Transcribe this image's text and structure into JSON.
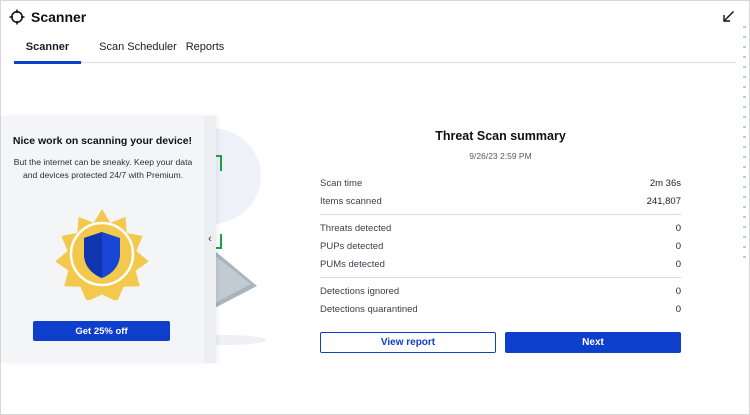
{
  "app": {
    "title": "Scanner"
  },
  "tabs": [
    {
      "label": "Scanner",
      "active": true
    },
    {
      "label": "Scan Scheduler",
      "active": false
    },
    {
      "label": "Reports",
      "active": false
    }
  ],
  "promo": {
    "title": "Nice work on scanning your device!",
    "body": "But the internet can be sneaky. Keep your data and devices protected 24/7 with Premium.",
    "button_label": "Get 25% off",
    "handle_glyph": "‹"
  },
  "summary": {
    "title": "Threat Scan summary",
    "date": "9/26/23 2:59 PM",
    "groups": [
      [
        {
          "label": "Scan time",
          "value": "2m 36s"
        },
        {
          "label": "Items scanned",
          "value": "241,807"
        }
      ],
      [
        {
          "label": "Threats detected",
          "value": "0"
        },
        {
          "label": "PUPs detected",
          "value": "0"
        },
        {
          "label": "PUMs detected",
          "value": "0"
        }
      ],
      [
        {
          "label": "Detections ignored",
          "value": "0"
        },
        {
          "label": "Detections quarantined",
          "value": "0"
        }
      ]
    ],
    "view_report_label": "View report",
    "next_label": "Next"
  },
  "colors": {
    "accent": "#0d3ecc",
    "badge_gold": "#f2c94c",
    "shield_blue": "#1746d6",
    "illustration_green": "#19a34a"
  },
  "icons": {
    "app": "crosshair-icon",
    "collapse": "arrow-down-left-icon",
    "badge": "shield-badge-icon"
  }
}
